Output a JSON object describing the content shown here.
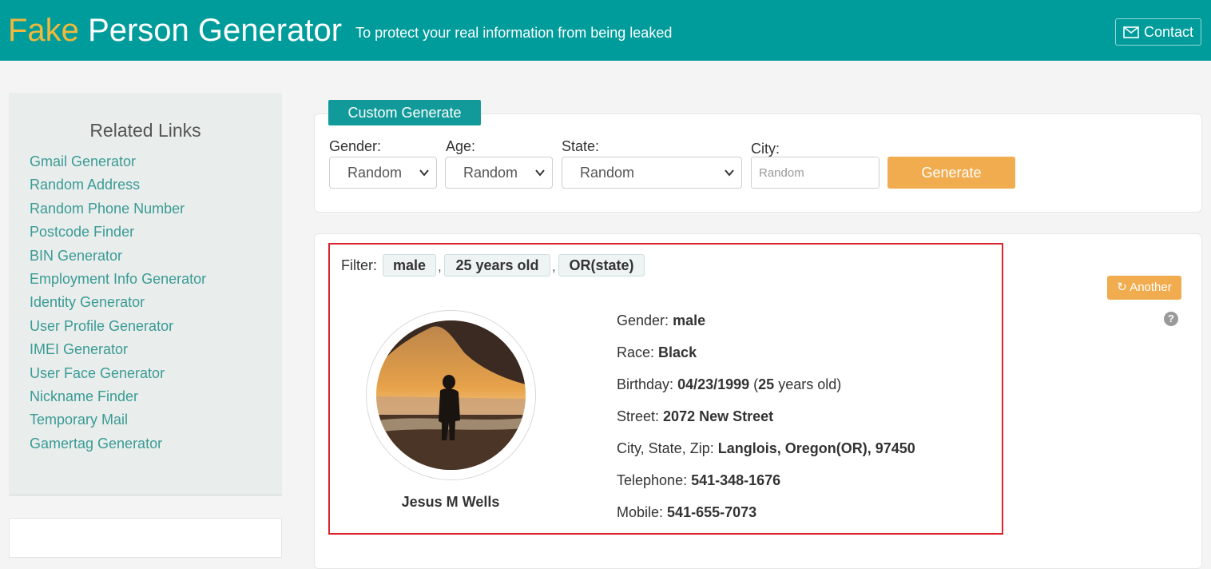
{
  "header": {
    "brand_fake": "Fake",
    "brand_rest": "Person Generator",
    "tagline": "To protect your real information from being leaked",
    "contact_label": "Contact",
    "bg_color": "#009c9c",
    "brand_accent": "#f0b93b"
  },
  "sidebar": {
    "title": "Related Links",
    "items": [
      {
        "label": "Gmail Generator"
      },
      {
        "label": "Random Address"
      },
      {
        "label": "Random Phone Number"
      },
      {
        "label": "Postcode Finder"
      },
      {
        "label": "BIN Generator"
      },
      {
        "label": "Employment Info Generator"
      },
      {
        "label": "Identity Generator"
      },
      {
        "label": "User Profile Generator"
      },
      {
        "label": "IMEI Generator"
      },
      {
        "label": "User Face Generator"
      },
      {
        "label": "Nickname Finder"
      },
      {
        "label": "Temporary Mail"
      },
      {
        "label": "Gamertag Generator"
      }
    ]
  },
  "generator": {
    "tab_label": "Custom Generate",
    "gender_label": "Gender:",
    "gender_value": "Random",
    "age_label": "Age:",
    "age_value": "Random",
    "state_label": "State:",
    "state_value": "Random",
    "city_label": "City:",
    "city_placeholder": "Random",
    "generate_label": "Generate"
  },
  "result": {
    "filter_label": "Filter:",
    "filters": [
      "male",
      "25 years old",
      "OR(state)"
    ],
    "another_label": "Another",
    "help_glyph": "?",
    "name": "Jesus M Wells",
    "fields": {
      "gender_label": "Gender:",
      "gender_value": "male",
      "race_label": "Race:",
      "race_value": "Black",
      "birthday_label": "Birthday:",
      "birthday_value": "04/23/1999",
      "age_open": "(",
      "age_value": "25",
      "age_suffix": "years old)",
      "street_label": "Street:",
      "street_value": "2072 New Street",
      "csz_label": "City, State, Zip:",
      "csz_value": "Langlois, Oregon(OR), 97450",
      "telephone_label": "Telephone:",
      "telephone_value": "541-348-1676",
      "mobile_label": "Mobile:",
      "mobile_value": "541-655-7073"
    }
  }
}
